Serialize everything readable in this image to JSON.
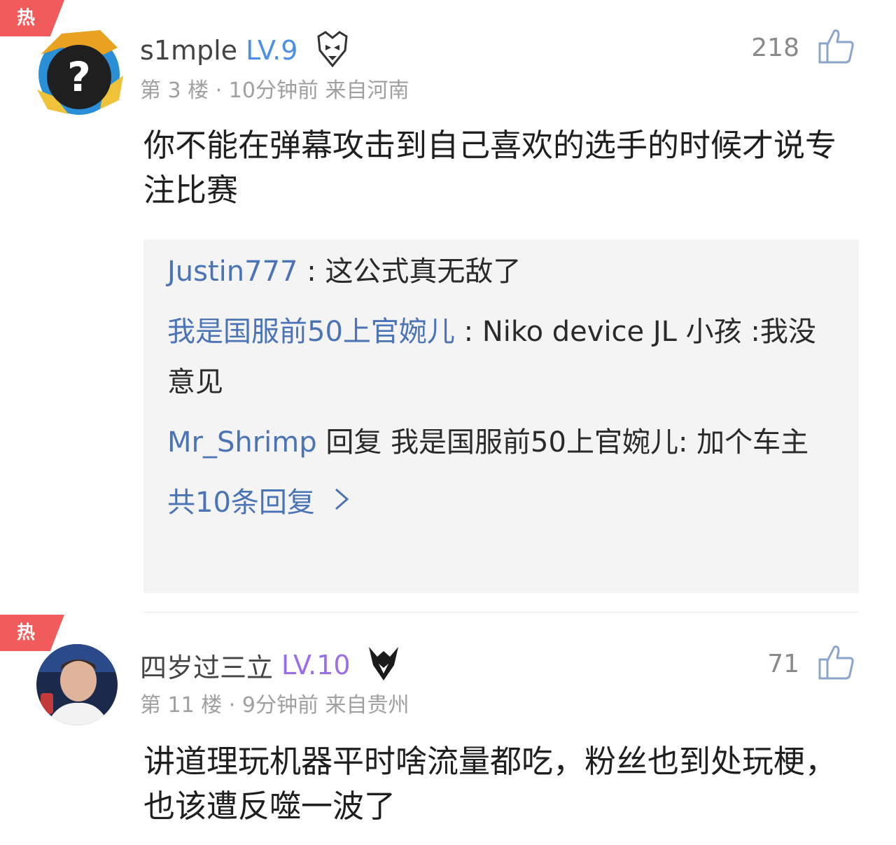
{
  "comments": [
    {
      "hot_label": "热",
      "username": "s1mple",
      "level": "LV.9",
      "level_color": "#4d8ee8",
      "team_icon": "g2-esports-icon",
      "meta": "第 3 楼 · 10分钟前  来自河南",
      "likes": "218",
      "body": "你不能在弹幕攻击到自己喜欢的选手的时候才说专注比赛",
      "replies": [
        {
          "author": "Justin777",
          "separator": " : ",
          "text": "这公式真无敌了"
        },
        {
          "author": "我是国服前50上官婉儿",
          "separator": " : ",
          "text": "Niko device JL 小孩 :我没意见"
        },
        {
          "author": "Mr_Shrimp",
          "reply_word": " 回复 ",
          "target": "我是国服前50上官婉儿",
          "separator": ": ",
          "text": "加个车主"
        }
      ],
      "more_replies_label": "共10条回复"
    },
    {
      "hot_label": "热",
      "username": "四岁过三立",
      "level": "LV.10",
      "level_color": "#9b6ee8",
      "team_icon": "team-vitality-icon",
      "meta": "第 11 楼 · 9分钟前  来自贵州",
      "likes": "71",
      "body": "讲道理玩机器平时啥流量都吃，粉丝也到处玩梗，也该遭反噬一波了"
    }
  ],
  "colors": {
    "hot_badge": "#f25b5b",
    "link_blue": "#4a74b5",
    "meta_gray": "#a0a0a0",
    "reply_bg": "#f4f4f4"
  }
}
